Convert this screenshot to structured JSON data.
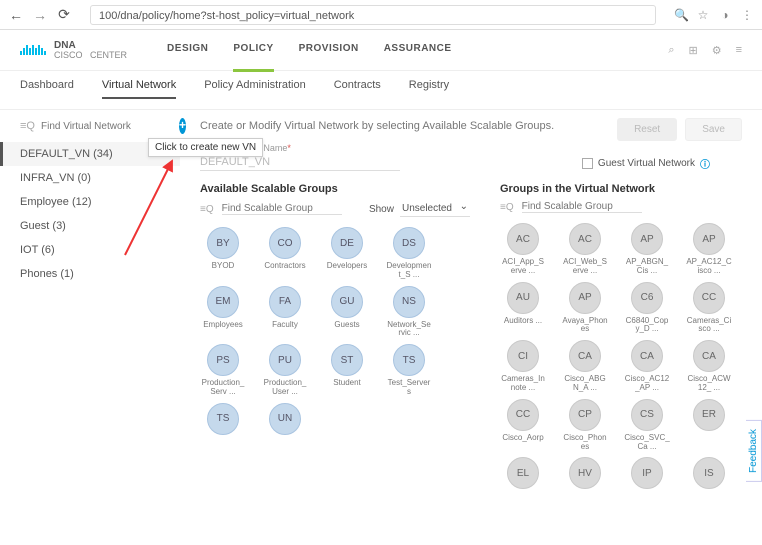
{
  "browser": {
    "url": "100/dna/policy/home?st-host_policy=virtual_network"
  },
  "logo": {
    "brand": "CISCO",
    "product": "DNA",
    "sub": "CENTER"
  },
  "main_nav": [
    "DESIGN",
    "POLICY",
    "PROVISION",
    "ASSURANCE"
  ],
  "sub_nav": [
    "Dashboard",
    "Virtual Network",
    "Policy Administration",
    "Contracts",
    "Registry"
  ],
  "sidebar": {
    "search_placeholder": "Find Virtual Network",
    "tooltip": "Click to create new VN",
    "items": [
      {
        "label": "DEFAULT_VN  (34)",
        "selected": true
      },
      {
        "label": "INFRA_VN  (0)"
      },
      {
        "label": "Employee  (12)"
      },
      {
        "label": "Guest  (3)"
      },
      {
        "label": "IOT  (6)"
      },
      {
        "label": "Phones  (1)"
      }
    ]
  },
  "content": {
    "intro": "Create or Modify Virtual Network by selecting Available Scalable Groups.",
    "reset": "Reset",
    "save": "Save",
    "vn_label": "Virtual Network Name",
    "vn_value": "DEFAULT_VN",
    "guest_label": "Guest Virtual Network"
  },
  "left_panel": {
    "title": "Available Scalable Groups",
    "search_placeholder": "Find Scalable Group",
    "show_label": "Show",
    "show_value": "Unselected",
    "chips": [
      {
        "abbr": "BY",
        "label": "BYOD"
      },
      {
        "abbr": "CO",
        "label": "Contractors"
      },
      {
        "abbr": "DE",
        "label": "Developers"
      },
      {
        "abbr": "DS",
        "label": "Development_S ..."
      },
      {
        "abbr": "EM",
        "label": "Employees"
      },
      {
        "abbr": "FA",
        "label": "Faculty"
      },
      {
        "abbr": "GU",
        "label": "Guests"
      },
      {
        "abbr": "NS",
        "label": "Network_Servic ..."
      },
      {
        "abbr": "PS",
        "label": "Production_Serv ..."
      },
      {
        "abbr": "PU",
        "label": "Production_User ..."
      },
      {
        "abbr": "ST",
        "label": "Student"
      },
      {
        "abbr": "TS",
        "label": "Test_Servers"
      },
      {
        "abbr": "TS",
        "label": ""
      },
      {
        "abbr": "UN",
        "label": ""
      }
    ]
  },
  "right_panel": {
    "title": "Groups in the Virtual Network",
    "search_placeholder": "Find Scalable Group",
    "chips": [
      {
        "abbr": "AC",
        "label": "ACI_App_Serve ..."
      },
      {
        "abbr": "AC",
        "label": "ACI_Web_Serve ..."
      },
      {
        "abbr": "AP",
        "label": "AP_ABGN_Cis ..."
      },
      {
        "abbr": "AP",
        "label": "AP_AC12_Cisco ..."
      },
      {
        "abbr": "AU",
        "label": "Auditors ..."
      },
      {
        "abbr": "AP",
        "label": "Avaya_Phones"
      },
      {
        "abbr": "C6",
        "label": "C6840_Copy_D ..."
      },
      {
        "abbr": "CC",
        "label": "Cameras_Cisco ..."
      },
      {
        "abbr": "CI",
        "label": "Cameras_Innote ..."
      },
      {
        "abbr": "CA",
        "label": "Cisco_ABGN_A ..."
      },
      {
        "abbr": "CA",
        "label": "Cisco_AC12_AP ..."
      },
      {
        "abbr": "CA",
        "label": "Cisco_ACW12_ ..."
      },
      {
        "abbr": "CC",
        "label": "Cisco_Aorp"
      },
      {
        "abbr": "CP",
        "label": "Cisco_Phones"
      },
      {
        "abbr": "CS",
        "label": "Cisco_SVC_Ca ..."
      },
      {
        "abbr": "ER",
        "label": ""
      },
      {
        "abbr": "EL",
        "label": ""
      },
      {
        "abbr": "HV",
        "label": ""
      },
      {
        "abbr": "IP",
        "label": ""
      },
      {
        "abbr": "IS",
        "label": ""
      }
    ]
  },
  "feedback": "Feedback"
}
